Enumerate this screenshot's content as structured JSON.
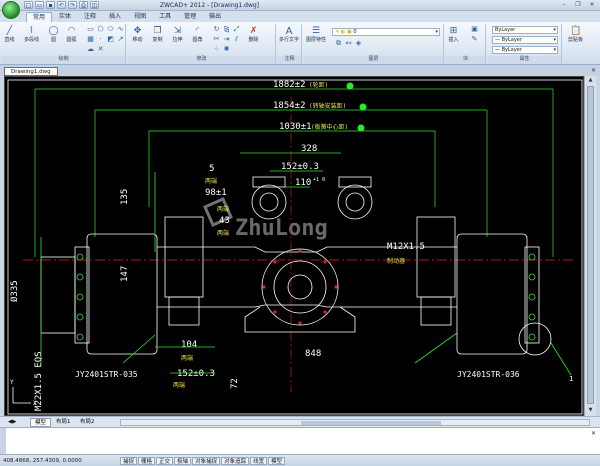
{
  "app": {
    "title": "ZWCAD+ 2012 - [Drawing1.dwg]",
    "window_controls": [
      "–",
      "❐",
      "✕"
    ],
    "qat_icons": [
      "new-icon",
      "open-icon",
      "save-icon",
      "undo-icon",
      "redo-icon",
      "print-icon",
      "preview-icon"
    ]
  },
  "tabs": [
    "常用",
    "实体",
    "注释",
    "插入",
    "视图",
    "工具",
    "管理",
    "输出"
  ],
  "ribbon": {
    "groups": [
      {
        "label": "绘制",
        "buttons": [
          "直线",
          "多段线",
          "圆",
          "圆弧"
        ]
      },
      {
        "label": "修改",
        "buttons": [
          "移动",
          "复制",
          "拉伸",
          "圆角",
          "删除"
        ]
      },
      {
        "label": "注释",
        "buttons": [
          "多行文字"
        ]
      },
      {
        "label": "图层",
        "buttons": [
          "图层特性"
        ]
      },
      {
        "label": "块",
        "buttons": [
          "插入"
        ]
      },
      {
        "label": "属性",
        "buttons": []
      },
      {
        "label": "",
        "buttons": [
          "剪贴板"
        ]
      }
    ],
    "layer_combo": "0",
    "property_combos": [
      "ByLayer",
      "— ByLayer",
      "— ByLayer"
    ]
  },
  "document_tab": "Drawing1.dwg",
  "layout_tabs": [
    "模型",
    "布局1",
    "布局2"
  ],
  "statusbar": {
    "coords": "408.4868, 257.4309, 0.0000",
    "toggles": [
      "捕捉",
      "栅格",
      "正交",
      "极轴",
      "对象捕捉",
      "对象追踪",
      "线宽",
      "模型"
    ]
  },
  "drawing": {
    "dims": {
      "d1882": "1882±2",
      "d1882_note": "(轮距)",
      "d1854": "1854±2",
      "d1854_note": "(转轴安装距)",
      "d1030": "1030±1",
      "d1030_note": "(板簧中心距)",
      "d328": "328",
      "d152_top": "152±0.3",
      "d110": "110",
      "d110_sup": "+1 0",
      "d5": "5",
      "d98": "98±1",
      "d43": "43",
      "d135": "135",
      "d147": "147",
      "d335": "Ø335",
      "d104": "104",
      "d848": "848",
      "d152_bot": "152±0.3",
      "d72": "72",
      "m12": "M12X1.5",
      "m22": "M22X1.5 EQS",
      "part_left": "JY2401STR-035",
      "part_right": "JY2401STR-036",
      "balloon": "1",
      "note_right": "制动器",
      "notes_small": [
        "两端",
        "两端",
        "两端",
        "两端",
        "两端"
      ]
    },
    "watermark": "ZhuLong"
  },
  "colors": {
    "canvas": "#000000",
    "dim": "#ffffff",
    "geometry_green": "#2ee62e",
    "axis_red": "#e02020",
    "note_yellow": "#f0e040",
    "center_cyan": "#33d6d6"
  }
}
